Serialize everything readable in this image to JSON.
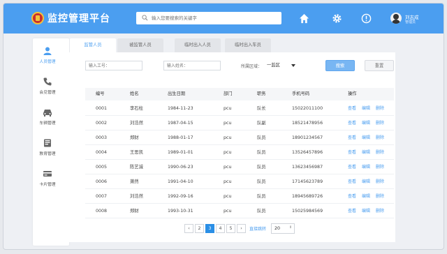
{
  "app": {
    "title": "监控管理平台",
    "search_placeholder": "输入您要搜索的关键字",
    "user_name": "刘志成",
    "user_role": "管理员"
  },
  "sidebar": {
    "items": [
      {
        "label": "人员管理",
        "icon": "person-icon"
      },
      {
        "label": "会见管理",
        "icon": "phone-icon"
      },
      {
        "label": "车辆管理",
        "icon": "car-icon"
      },
      {
        "label": "教育管理",
        "icon": "book-icon"
      },
      {
        "label": "卡片管理",
        "icon": "card-icon"
      }
    ]
  },
  "tabs": [
    "监管人员",
    "被监管人员",
    "临时出入人员",
    "临时出入车员"
  ],
  "filters": {
    "emp_id_placeholder": "输入工号：",
    "name_placeholder": "输入姓名：",
    "region_label": "所属区域：",
    "region_value": "一监区",
    "search_button": "搜索",
    "reset_button": "重置"
  },
  "table": {
    "headers": [
      "编号",
      "姓名",
      "出生日期",
      "部门",
      "职务",
      "手机号码",
      "操作"
    ],
    "actions": [
      "查看",
      "编辑",
      "删除"
    ],
    "rows": [
      [
        "0001",
        "李石柱",
        "1984-11-23",
        "pcu",
        "队长",
        "15022011100"
      ],
      [
        "0002",
        "刘浩然",
        "1987-04-15",
        "pcu",
        "队副",
        "18521478956"
      ],
      [
        "0003",
        "郑财",
        "1988-01-17",
        "pcu",
        "队员",
        "18901234567"
      ],
      [
        "0004",
        "王思凯",
        "1989-01-01",
        "pcu",
        "队员",
        "13526457896"
      ],
      [
        "0005",
        "陈艺诚",
        "1990-06-23",
        "pcu",
        "队员",
        "13623456987"
      ],
      [
        "0006",
        "萧然",
        "1991-04-10",
        "pcu",
        "队员",
        "17145623789"
      ],
      [
        "0007",
        "刘浩然",
        "1992-09-16",
        "pcu",
        "队员",
        "18945689726"
      ],
      [
        "0008",
        "郑财",
        "1993-10-31",
        "pcu",
        "队员",
        "15025984569"
      ]
    ]
  },
  "pagination": {
    "prev": "‹",
    "next": "›",
    "pages": [
      "2",
      "3",
      "4",
      "5"
    ],
    "current": "3",
    "jump_label": "直接跳转",
    "jump_value": "20",
    "spin": "⇕"
  },
  "colors": {
    "header": "#4b9ef0",
    "accent": "#2a8fe6"
  }
}
